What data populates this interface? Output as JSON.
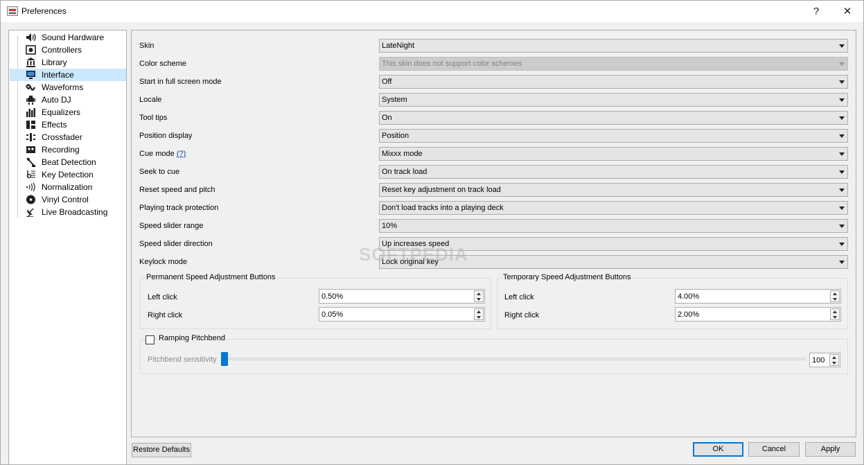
{
  "window": {
    "title": "Preferences",
    "help_glyph": "?",
    "close_glyph": "✕"
  },
  "sidebar": {
    "items": [
      {
        "label": "Sound Hardware",
        "icon": "speaker-icon"
      },
      {
        "label": "Controllers",
        "icon": "controller-icon"
      },
      {
        "label": "Library",
        "icon": "library-icon"
      },
      {
        "label": "Interface",
        "icon": "monitor-icon",
        "selected": true
      },
      {
        "label": "Waveforms",
        "icon": "waveform-icon"
      },
      {
        "label": "Auto DJ",
        "icon": "robot-icon"
      },
      {
        "label": "Equalizers",
        "icon": "equalizer-icon"
      },
      {
        "label": "Effects",
        "icon": "effects-icon"
      },
      {
        "label": "Crossfader",
        "icon": "crossfader-icon"
      },
      {
        "label": "Recording",
        "icon": "cassette-icon"
      },
      {
        "label": "Beat Detection",
        "icon": "metronome-icon"
      },
      {
        "label": "Key Detection",
        "icon": "music-key-icon"
      },
      {
        "label": "Normalization",
        "icon": "normalization-icon"
      },
      {
        "label": "Vinyl Control",
        "icon": "vinyl-icon"
      },
      {
        "label": "Live Broadcasting",
        "icon": "satellite-dish-icon"
      }
    ]
  },
  "settings": {
    "rows": [
      {
        "label": "Skin",
        "value": "LateNight"
      },
      {
        "label": "Color scheme",
        "value": "This skin does not support color schemes",
        "disabled": true
      },
      {
        "label": "Start in full screen mode",
        "value": "Off"
      },
      {
        "label": "Locale",
        "value": "System"
      },
      {
        "label": "Tool tips",
        "value": "On"
      },
      {
        "label": "Position display",
        "value": "Position"
      },
      {
        "label": "Cue mode",
        "value": "Mixxx mode",
        "help_link": "(?)"
      },
      {
        "label": "Seek to cue",
        "value": "On track load"
      },
      {
        "label": "Reset speed and pitch",
        "value": "Reset key adjustment on track load"
      },
      {
        "label": "Playing track protection",
        "value": "Don't load tracks into a playing deck"
      },
      {
        "label": "Speed slider range",
        "value": "10%"
      },
      {
        "label": "Speed slider direction",
        "value": "Up increases speed"
      },
      {
        "label": "Keylock mode",
        "value": "Lock original key"
      }
    ],
    "permanent": {
      "title": "Permanent Speed Adjustment Buttons",
      "left_label": "Left click",
      "left_value": "0.50%",
      "right_label": "Right click",
      "right_value": "0.05%"
    },
    "temporary": {
      "title": "Temporary Speed Adjustment Buttons",
      "left_label": "Left click",
      "left_value": "4.00%",
      "right_label": "Right click",
      "right_value": "2.00%"
    },
    "ramping": {
      "checkbox_label": "Ramping Pitchbend",
      "checked": false,
      "sensitivity_label": "Pitchbend sensitivity",
      "sensitivity_value": "100"
    }
  },
  "buttons": {
    "restore": "Restore Defaults",
    "ok": "OK",
    "cancel": "Cancel",
    "apply": "Apply"
  },
  "watermark": "SOFTPEDIA",
  "colors": {
    "accent": "#0078d7",
    "selection": "#cce8ff"
  }
}
